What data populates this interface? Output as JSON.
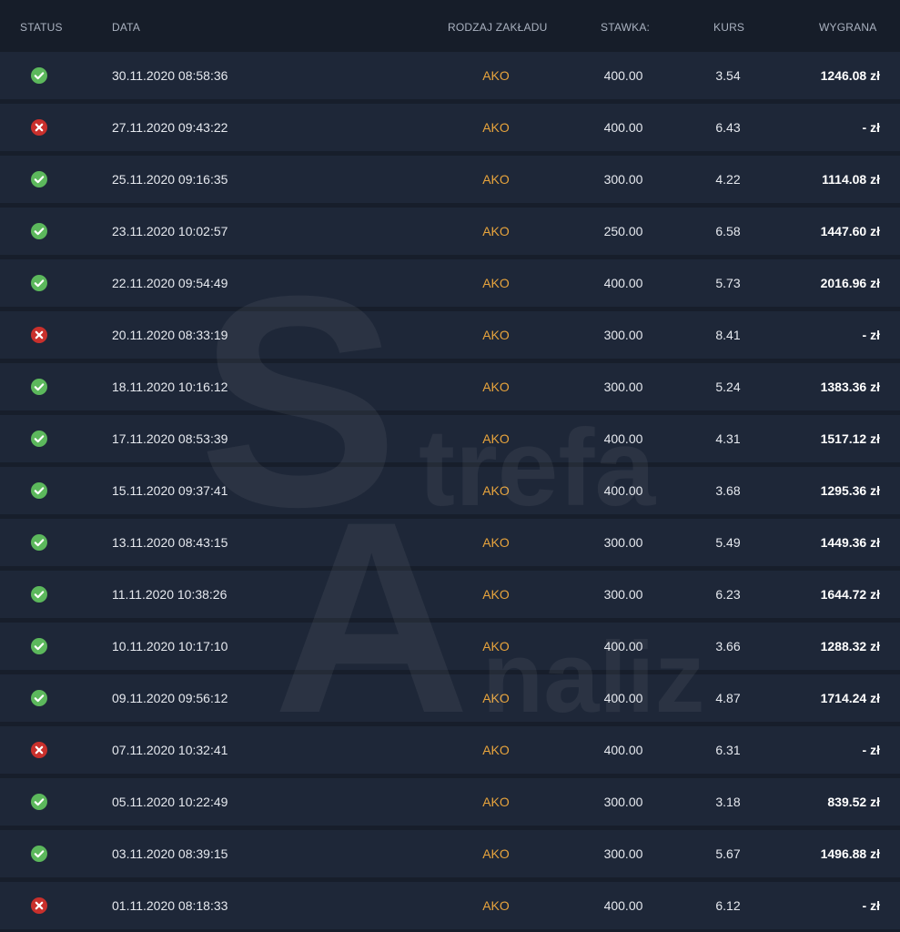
{
  "colors": {
    "background": "#171e2b",
    "row": "#1e2738",
    "bet_type": "#e8a43c",
    "win": "#5cb85c",
    "loss": "#c9302c"
  },
  "header": {
    "status": "STATUS",
    "date": "DATA",
    "bet_type": "RODZAJ ZAKŁADU",
    "stake": "STAWKA:",
    "odds": "KURS",
    "win": "WYGRANA"
  },
  "watermark": {
    "letter_s": "S",
    "trefa": "trefa",
    "letter_a": "A",
    "naliz": "naliz"
  },
  "rows": [
    {
      "status": "win",
      "status_icon": "check-circle-icon",
      "date": "30.11.2020 08:58:36",
      "type": "AKO",
      "stake": "400.00",
      "odds": "3.54",
      "win": "1246.08 zł"
    },
    {
      "status": "loss",
      "status_icon": "x-circle-icon",
      "date": "27.11.2020 09:43:22",
      "type": "AKO",
      "stake": "400.00",
      "odds": "6.43",
      "win": "- zł"
    },
    {
      "status": "win",
      "status_icon": "check-circle-icon",
      "date": "25.11.2020 09:16:35",
      "type": "AKO",
      "stake": "300.00",
      "odds": "4.22",
      "win": "1114.08 zł"
    },
    {
      "status": "win",
      "status_icon": "check-circle-icon",
      "date": "23.11.2020 10:02:57",
      "type": "AKO",
      "stake": "250.00",
      "odds": "6.58",
      "win": "1447.60 zł"
    },
    {
      "status": "win",
      "status_icon": "check-circle-icon",
      "date": "22.11.2020 09:54:49",
      "type": "AKO",
      "stake": "400.00",
      "odds": "5.73",
      "win": "2016.96 zł"
    },
    {
      "status": "loss",
      "status_icon": "x-circle-icon",
      "date": "20.11.2020 08:33:19",
      "type": "AKO",
      "stake": "300.00",
      "odds": "8.41",
      "win": "- zł"
    },
    {
      "status": "win",
      "status_icon": "check-circle-icon",
      "date": "18.11.2020 10:16:12",
      "type": "AKO",
      "stake": "300.00",
      "odds": "5.24",
      "win": "1383.36 zł"
    },
    {
      "status": "win",
      "status_icon": "check-circle-icon",
      "date": "17.11.2020 08:53:39",
      "type": "AKO",
      "stake": "400.00",
      "odds": "4.31",
      "win": "1517.12 zł"
    },
    {
      "status": "win",
      "status_icon": "check-circle-icon",
      "date": "15.11.2020 09:37:41",
      "type": "AKO",
      "stake": "400.00",
      "odds": "3.68",
      "win": "1295.36 zł"
    },
    {
      "status": "win",
      "status_icon": "check-circle-icon",
      "date": "13.11.2020 08:43:15",
      "type": "AKO",
      "stake": "300.00",
      "odds": "5.49",
      "win": "1449.36 zł"
    },
    {
      "status": "win",
      "status_icon": "check-circle-icon",
      "date": "11.11.2020 10:38:26",
      "type": "AKO",
      "stake": "300.00",
      "odds": "6.23",
      "win": "1644.72 zł"
    },
    {
      "status": "win",
      "status_icon": "check-circle-icon",
      "date": "10.11.2020 10:17:10",
      "type": "AKO",
      "stake": "400.00",
      "odds": "3.66",
      "win": "1288.32 zł"
    },
    {
      "status": "win",
      "status_icon": "check-circle-icon",
      "date": "09.11.2020 09:56:12",
      "type": "AKO",
      "stake": "400.00",
      "odds": "4.87",
      "win": "1714.24 zł"
    },
    {
      "status": "loss",
      "status_icon": "x-circle-icon",
      "date": "07.11.2020 10:32:41",
      "type": "AKO",
      "stake": "400.00",
      "odds": "6.31",
      "win": "- zł"
    },
    {
      "status": "win",
      "status_icon": "check-circle-icon",
      "date": "05.11.2020 10:22:49",
      "type": "AKO",
      "stake": "300.00",
      "odds": "3.18",
      "win": "839.52 zł"
    },
    {
      "status": "win",
      "status_icon": "check-circle-icon",
      "date": "03.11.2020 08:39:15",
      "type": "AKO",
      "stake": "300.00",
      "odds": "5.67",
      "win": "1496.88 zł"
    },
    {
      "status": "loss",
      "status_icon": "x-circle-icon",
      "date": "01.11.2020 08:18:33",
      "type": "AKO",
      "stake": "400.00",
      "odds": "6.12",
      "win": "- zł"
    }
  ]
}
